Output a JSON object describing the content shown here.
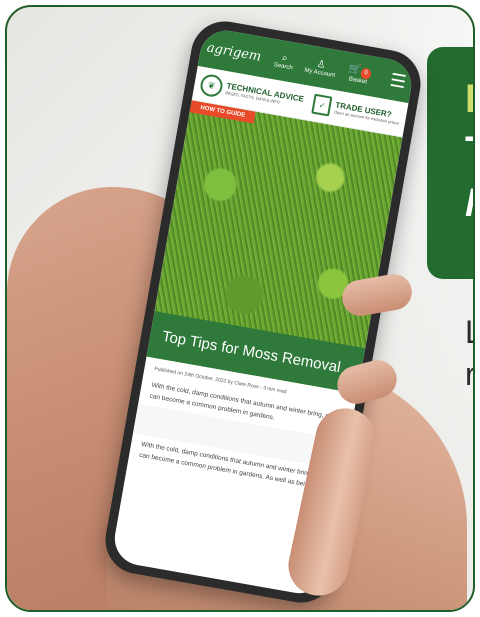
{
  "headline": {
    "line1": "H",
    "line2": "T",
    "line3": "M"
  },
  "lead": {
    "line1": "L",
    "line2": "re"
  },
  "phone": {
    "nav": {
      "logo": "agrigem",
      "search_label": "Search",
      "account_label": "My Account",
      "basket_label": "Basket",
      "basket_count": "0"
    },
    "advice": {
      "title": "TECHNICAL ADVICE",
      "subtitle": "PAGES, FACTS, DATA & INFO",
      "trade_title": "TRADE USER?",
      "trade_subtitle": "Open an account for exclusive prices"
    },
    "article": {
      "tag": "HOW TO GUIDE",
      "title": "Top Tips for Moss Removal",
      "meta": "Published on 24th October, 2022 by Clare Rose - 3 min read",
      "para1": "With the cold, damp conditions that autumn and winter bring, moss can become a common problem in gardens.",
      "para2": "With the cold, damp conditions that autumn and winter bring, moss can become a common problem in gardens. As well as being"
    }
  }
}
